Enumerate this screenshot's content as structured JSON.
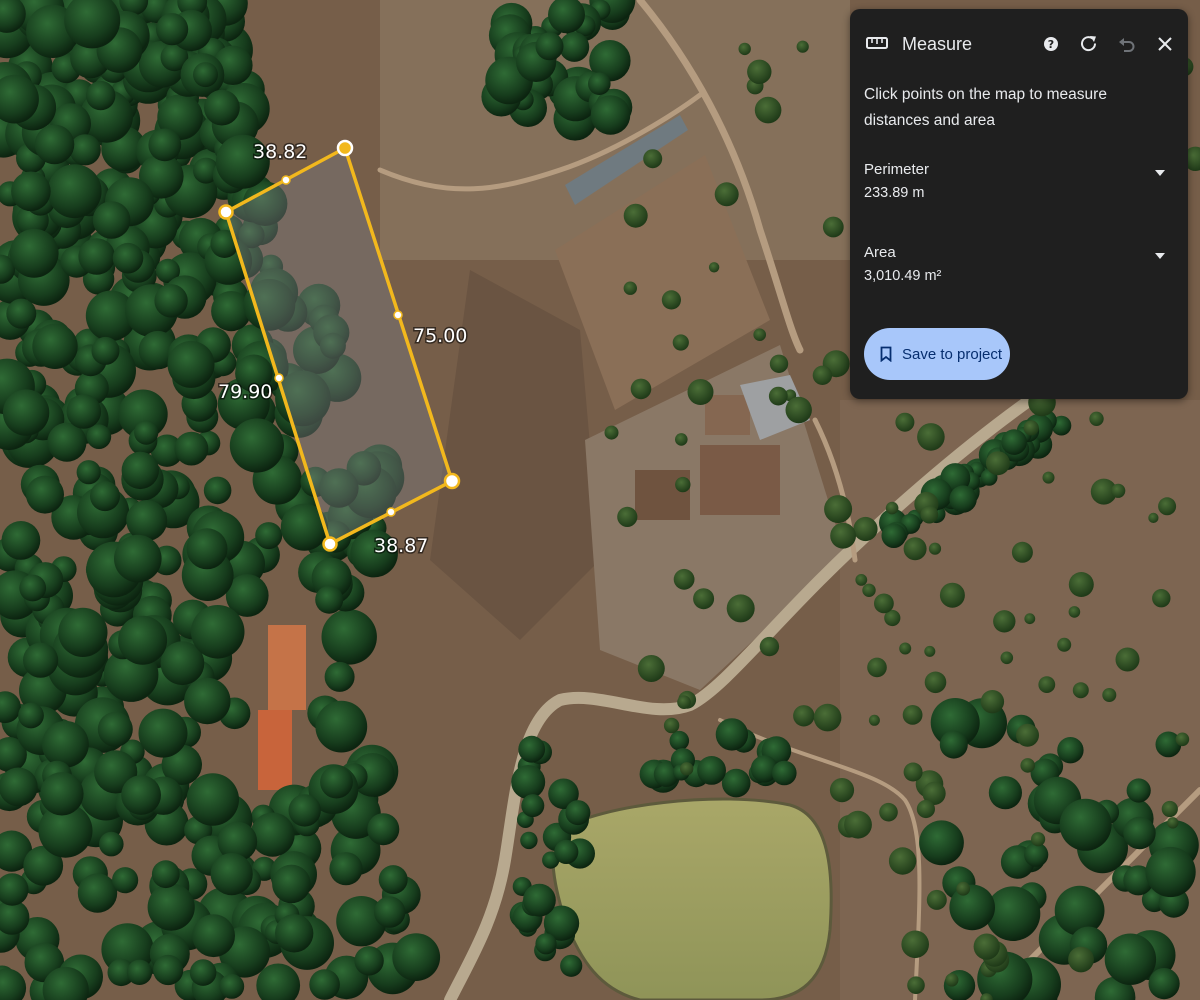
{
  "panel": {
    "title": "Measure",
    "instructions": "Click points on the map to measure distances and area",
    "perimeter_label": "Perimeter",
    "perimeter_value": "233.89 m",
    "area_label": "Area",
    "area_value": "3,010.49 m²",
    "save_label": "Save to project",
    "accent_color": "#a8c7fa",
    "icons": [
      "ruler-icon",
      "help-icon",
      "refresh-icon",
      "undo-icon",
      "close-icon",
      "chevron-down-icon",
      "bookmark-icon"
    ]
  },
  "map": {
    "type": "satellite",
    "segments": [
      {
        "label": "38.82"
      },
      {
        "label": "75.00"
      },
      {
        "label": "38.87"
      },
      {
        "label": "79.90"
      }
    ],
    "polygon_color": "#f2b81d"
  }
}
